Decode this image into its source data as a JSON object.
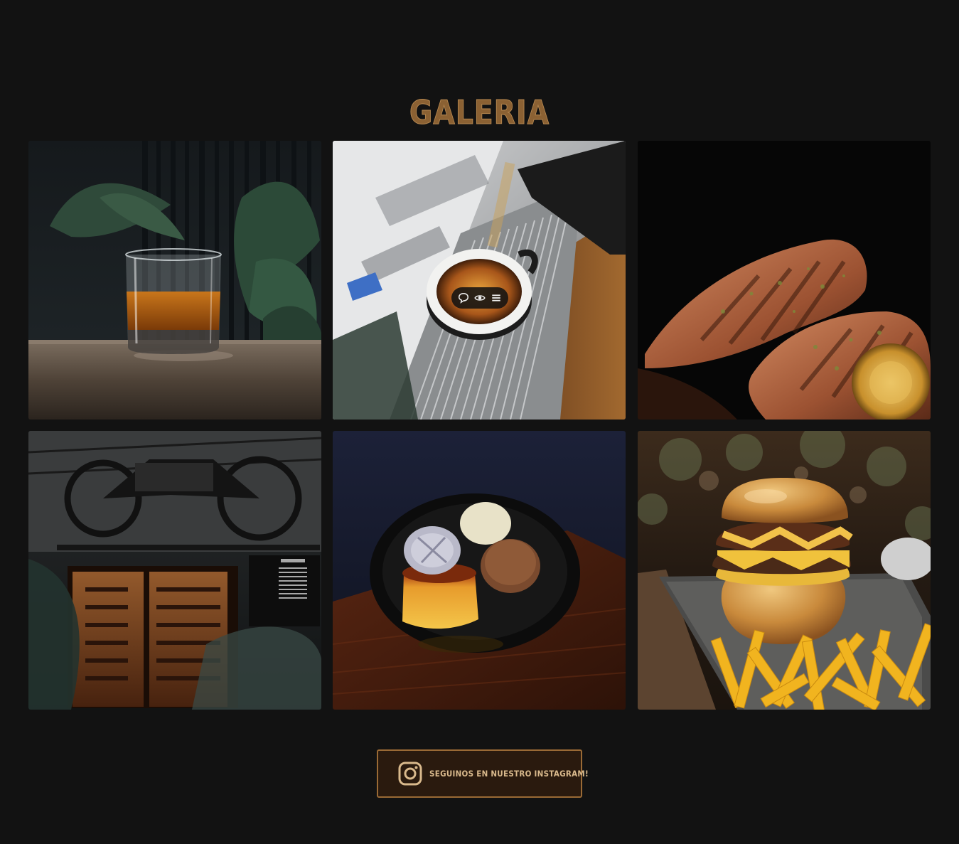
{
  "gallery": {
    "title": "GALERIA",
    "items": [
      {
        "image": "whisky-glass-photo"
      },
      {
        "image": "espresso-machine-photo"
      },
      {
        "image": "grilled-salmon-photo"
      },
      {
        "image": "wine-cellar-motorcycle-photo"
      },
      {
        "image": "flan-ice-cream-dessert-photo"
      },
      {
        "image": "burger-and-fries-photo"
      }
    ],
    "overlay_toolbar": {
      "icons": [
        "comment-icon",
        "eye-icon",
        "menu-icon"
      ]
    }
  },
  "instagram_button": {
    "label": "SEGUINOS EN NUESTRO INSTAGRAM!",
    "icon": "instagram-icon"
  },
  "colors": {
    "background": "#121212",
    "accent": "#9a6a35",
    "title": "#8b6133",
    "button_bg": "#2a1a0e",
    "button_text": "#d9b98c"
  }
}
